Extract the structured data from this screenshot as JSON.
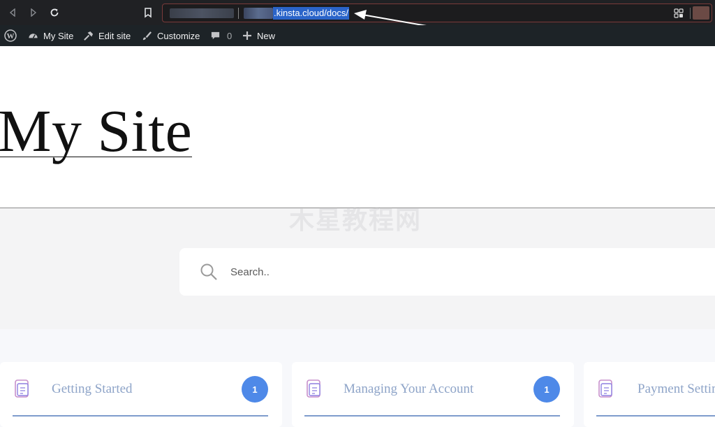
{
  "browser": {
    "url_visible": ".kinsta.cloud/docs/"
  },
  "admin_bar": {
    "items": [
      {
        "label": "My Site",
        "icon": "dashboard-icon"
      },
      {
        "label": "Edit site",
        "icon": "hammer-icon"
      },
      {
        "label": "Customize",
        "icon": "brush-icon"
      },
      {
        "label": "0",
        "icon": "comment-icon"
      },
      {
        "label": "New",
        "icon": "plus-icon"
      }
    ]
  },
  "header": {
    "site_title": "My Site"
  },
  "watermark": "木星教程网",
  "search": {
    "placeholder": "Search.."
  },
  "cards": [
    {
      "title": "Getting Started",
      "count": "1",
      "icon": "document-folder-icon"
    },
    {
      "title": "Managing Your Account",
      "count": "1",
      "icon": "document-folder-icon"
    },
    {
      "title": "Payment Settings",
      "icon": "document-folder-icon"
    }
  ],
  "colors": {
    "accent": "#4e89e8",
    "card_title": "#8ea4c8",
    "admin_bar": "#1d2327",
    "url_highlight": "#2a64c9"
  }
}
